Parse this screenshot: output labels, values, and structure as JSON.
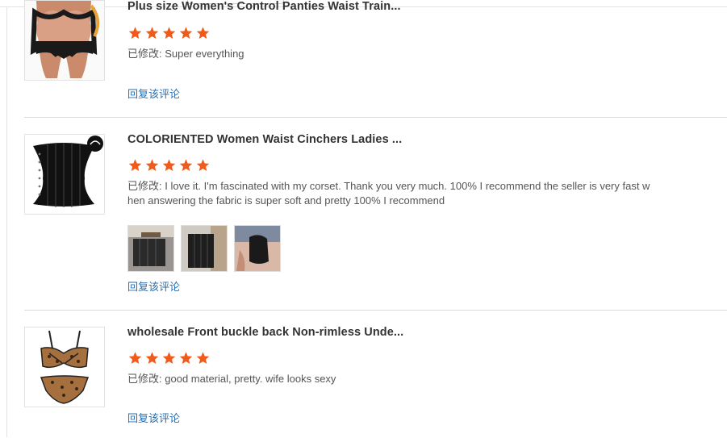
{
  "colors": {
    "star": "#f05a1a",
    "link": "#2a6fb0",
    "text": "#555555",
    "title": "#333333",
    "divider": "#dcdcdc"
  },
  "reviews": [
    {
      "title": "Plus size Women's Control Panties Waist Train...",
      "rating": 5,
      "label": "已修改:",
      "text": "Super everything",
      "reply_label": "回复该评论",
      "thumbnail": "panties-product-image"
    },
    {
      "title": "COLORIENTED Women Waist Cinchers Ladies ...",
      "rating": 5,
      "label": "已修改:",
      "text": "I love it. I'm fascinated with my corset. Thank you very much. 100% I recommend the seller is very fast when answering the fabric is super soft and pretty 100% I recommend",
      "reply_label": "回复该评论",
      "thumbnail": "corset-product-image",
      "photos": [
        "review-photo-1",
        "review-photo-2",
        "review-photo-3"
      ]
    },
    {
      "title": "wholesale Front buckle back Non-rimless Unde...",
      "rating": 5,
      "label": "已修改:",
      "text": "good material, pretty. wife looks sexy",
      "reply_label": "回复该评论",
      "thumbnail": "leopard-lingerie-image"
    }
  ]
}
